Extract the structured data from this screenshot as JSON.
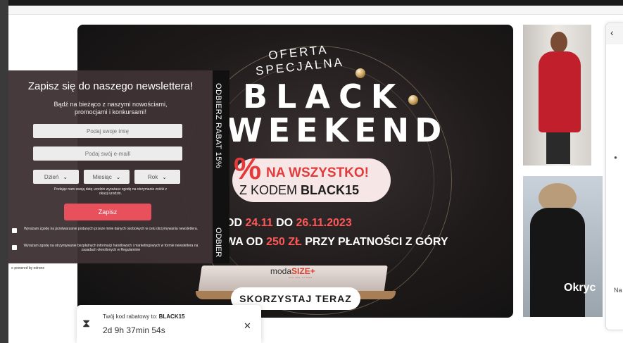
{
  "newsletter": {
    "title": "Zapisz się do naszego newslettera!",
    "subtitle": "Bądź na bieżąco z naszymi nowościami, promocjami i konkursami!",
    "name_placeholder": "Podaj swoje imię",
    "email_placeholder": "Podaj swój e-maill",
    "day_select": "Dzień",
    "month_select": "Miesiąc",
    "year_select": "Rok",
    "birthday_note": "Podając nam swoją datę urodzin wyrażasz zgodę na otrzymanie zniżki z okazji urodzin.",
    "submit_label": "Zapisz",
    "consent1": "Wyrażam zgodę na przetwarzanie podanych przeze mnie danych osobowych w celu otrzymywania newslettera.",
    "consent2": "Wyrażam zgodę na otrzymywanie bezpłatnych informacji handlowych i marketingowych w formie newslettera na zasadach określonych w Regulaminie",
    "powered_by": "powered by edrone"
  },
  "side_tab": {
    "text": "ODBIERZ RABAT 15%",
    "text2": "ODBIER"
  },
  "hero": {
    "subtitle": "OFERTA SPECJALNA",
    "line1": "BLACK",
    "line2": "WEEKEND",
    "percent": "%",
    "promo_line1": "NA WSZYSTKO!",
    "promo_line2_prefix": "Z KODEM",
    "promo_code": "BLACK15",
    "dates_prefix": "OD",
    "date_from": "24.11",
    "dates_mid": "DO",
    "date_to": "26.11.2023",
    "condition_prefix": "WA OD",
    "condition_amount": "250 ZŁ",
    "condition_suffix": "PRZY PŁATNOŚCI Z GÓRY",
    "brand_prefix": "moda",
    "brand_main": "SIZE+",
    "brand_sub": "ONLINE STORE",
    "cta_label": "SKORZYSTAJ TERAZ"
  },
  "products": {
    "second_title": "Okryc"
  },
  "right_panel": {
    "back_icon": "‹",
    "text": "Na"
  },
  "timer": {
    "label_prefix": "Twój kod rabatowy to:",
    "code": "BLACK15",
    "countdown": "2d 9h 37min 54s",
    "close": "✕"
  },
  "colors": {
    "accent_red": "#e8505b",
    "promo_red": "#e33b3b",
    "popup_bg": "#3e3234"
  }
}
